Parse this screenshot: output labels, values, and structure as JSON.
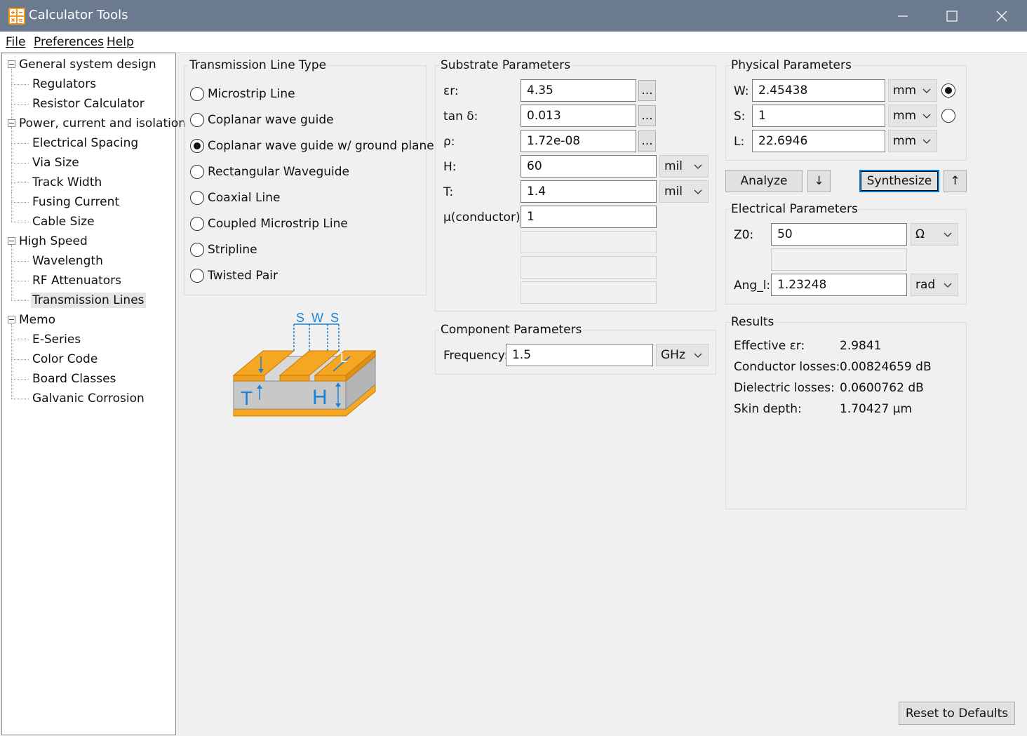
{
  "window": {
    "title": "Calculator Tools",
    "minimize_glyph": "—",
    "maximize_glyph": "☐",
    "close_glyph": "✕"
  },
  "menu": [
    "File",
    "Preferences",
    "Help"
  ],
  "tree": {
    "groups": [
      {
        "label": "General system design",
        "children": [
          "Regulators",
          "Resistor Calculator"
        ]
      },
      {
        "label": "Power, current and isolation",
        "children": [
          "Electrical Spacing",
          "Via Size",
          "Track Width",
          "Fusing Current",
          "Cable Size"
        ]
      },
      {
        "label": "High Speed",
        "children": [
          "Wavelength",
          "RF Attenuators",
          "Transmission Lines"
        ]
      },
      {
        "label": "Memo",
        "children": [
          "E-Series",
          "Color Code",
          "Board Classes",
          "Galvanic Corrosion"
        ]
      }
    ],
    "selected": "Transmission Lines"
  },
  "line_type": {
    "title": "Transmission Line Type",
    "options": [
      "Microstrip Line",
      "Coplanar wave guide",
      "Coplanar wave guide w/ ground plane",
      "Rectangular Waveguide",
      "Coaxial Line",
      "Coupled Microstrip Line",
      "Stripline",
      "Twisted Pair"
    ],
    "selected_index": 2
  },
  "diagram": {
    "labels": {
      "s1": "S",
      "w": "W",
      "s2": "S",
      "t": "T",
      "h": "H",
      "l": "L"
    },
    "colors": {
      "copper": "#f5a623",
      "copper_edge": "#c77c00",
      "substrate": "#c8c8c8",
      "dim": "#1a82d9"
    }
  },
  "substrate": {
    "title": "Substrate Parameters",
    "er_label": "εr:",
    "er_value": "4.35",
    "tand_label": "tan δ:",
    "tand_value": "0.013",
    "rho_label": "ρ:",
    "rho_value": "1.72e-08",
    "h_label": "H:",
    "h_value": "60",
    "h_unit": "mil",
    "t_label": "T:",
    "t_value": "1.4",
    "t_unit": "mil",
    "mu_label": "μ(conductor):",
    "mu_value": "1",
    "browse_label": "..."
  },
  "component": {
    "title": "Component Parameters",
    "freq_label": "Frequency:",
    "freq_value": "1.5",
    "freq_unit": "GHz"
  },
  "physical": {
    "title": "Physical Parameters",
    "w_label": "W:",
    "w_value": "2.45438",
    "w_unit": "mm",
    "s_label": "S:",
    "s_value": "1",
    "s_unit": "mm",
    "l_label": "L:",
    "l_value": "22.6946",
    "l_unit": "mm",
    "synth_target": "W"
  },
  "actions": {
    "analyze": "Analyze",
    "analyze_arrow": "↓",
    "synthesize": "Synthesize",
    "synthesize_arrow": "↑",
    "reset": "Reset to Defaults"
  },
  "electrical": {
    "title": "Electrical Parameters",
    "z0_label": "Z0:",
    "z0_value": "50",
    "z0_unit": "Ω",
    "ang_label": "Ang_l:",
    "ang_value": "1.23248",
    "ang_unit": "rad"
  },
  "results": {
    "title": "Results",
    "rows": [
      {
        "label": "Effective εr:",
        "value": "2.9841"
      },
      {
        "label": "Conductor losses:",
        "value": "0.00824659 dB"
      },
      {
        "label": "Dielectric losses:",
        "value": "0.0600762 dB"
      },
      {
        "label": "Skin depth:",
        "value": "1.70427 µm"
      }
    ]
  },
  "icons": {
    "app": "calculator-icon",
    "expander": "collapse-minus-icon",
    "dropdown": "chevron-down-icon"
  },
  "colors": {
    "titlebar": "#6b7a8f",
    "focus_border": "#0078d7",
    "window_bg": "#f0f0f0"
  }
}
